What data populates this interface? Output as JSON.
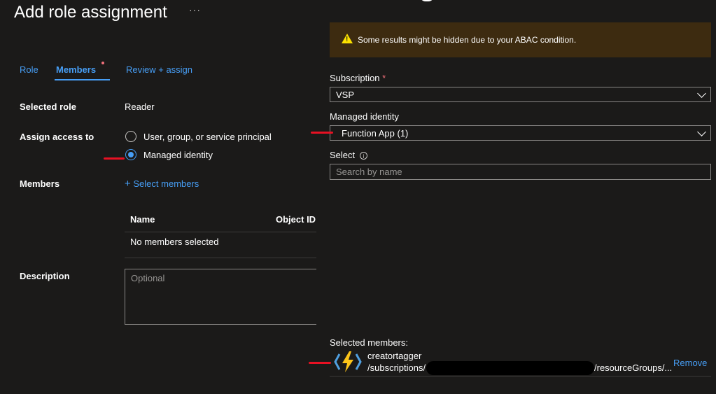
{
  "left": {
    "title": "Add role assignment",
    "more_label": "···",
    "tabs": [
      {
        "label": "Role"
      },
      {
        "label": "Members"
      },
      {
        "label": "Review + assign"
      }
    ],
    "selected_role_label": "Selected role",
    "selected_role_value": "Reader",
    "assign_access_label": "Assign access to",
    "assign_options": [
      {
        "label": "User, group, or service principal",
        "checked": false
      },
      {
        "label": "Managed identity",
        "checked": true
      }
    ],
    "members_label": "Members",
    "select_members_link": "Select members",
    "table": {
      "columns": [
        "Name",
        "Object ID"
      ],
      "empty_text": "No members selected"
    },
    "description_label": "Description",
    "description_placeholder": "Optional"
  },
  "right": {
    "banner_text": "Some results might be hidden due to your ABAC condition.",
    "subscription_label": "Subscription",
    "required_marker": "*",
    "subscription_value": "VSP",
    "managed_identity_label": "Managed identity",
    "managed_identity_value": "Function App (1)",
    "select_label": "Select",
    "search_placeholder": "Search by name",
    "selected_members_label": "Selected members:",
    "member": {
      "name": "creatortagger",
      "path_start": "/subscriptions/",
      "path_end": "/resourceGroups/...",
      "remove_label": "Remove"
    }
  },
  "colors": {
    "accent": "#479ef5",
    "warning_bg": "#3d2b10",
    "warning_icon": "#fce100",
    "annotation": "#e81123"
  }
}
